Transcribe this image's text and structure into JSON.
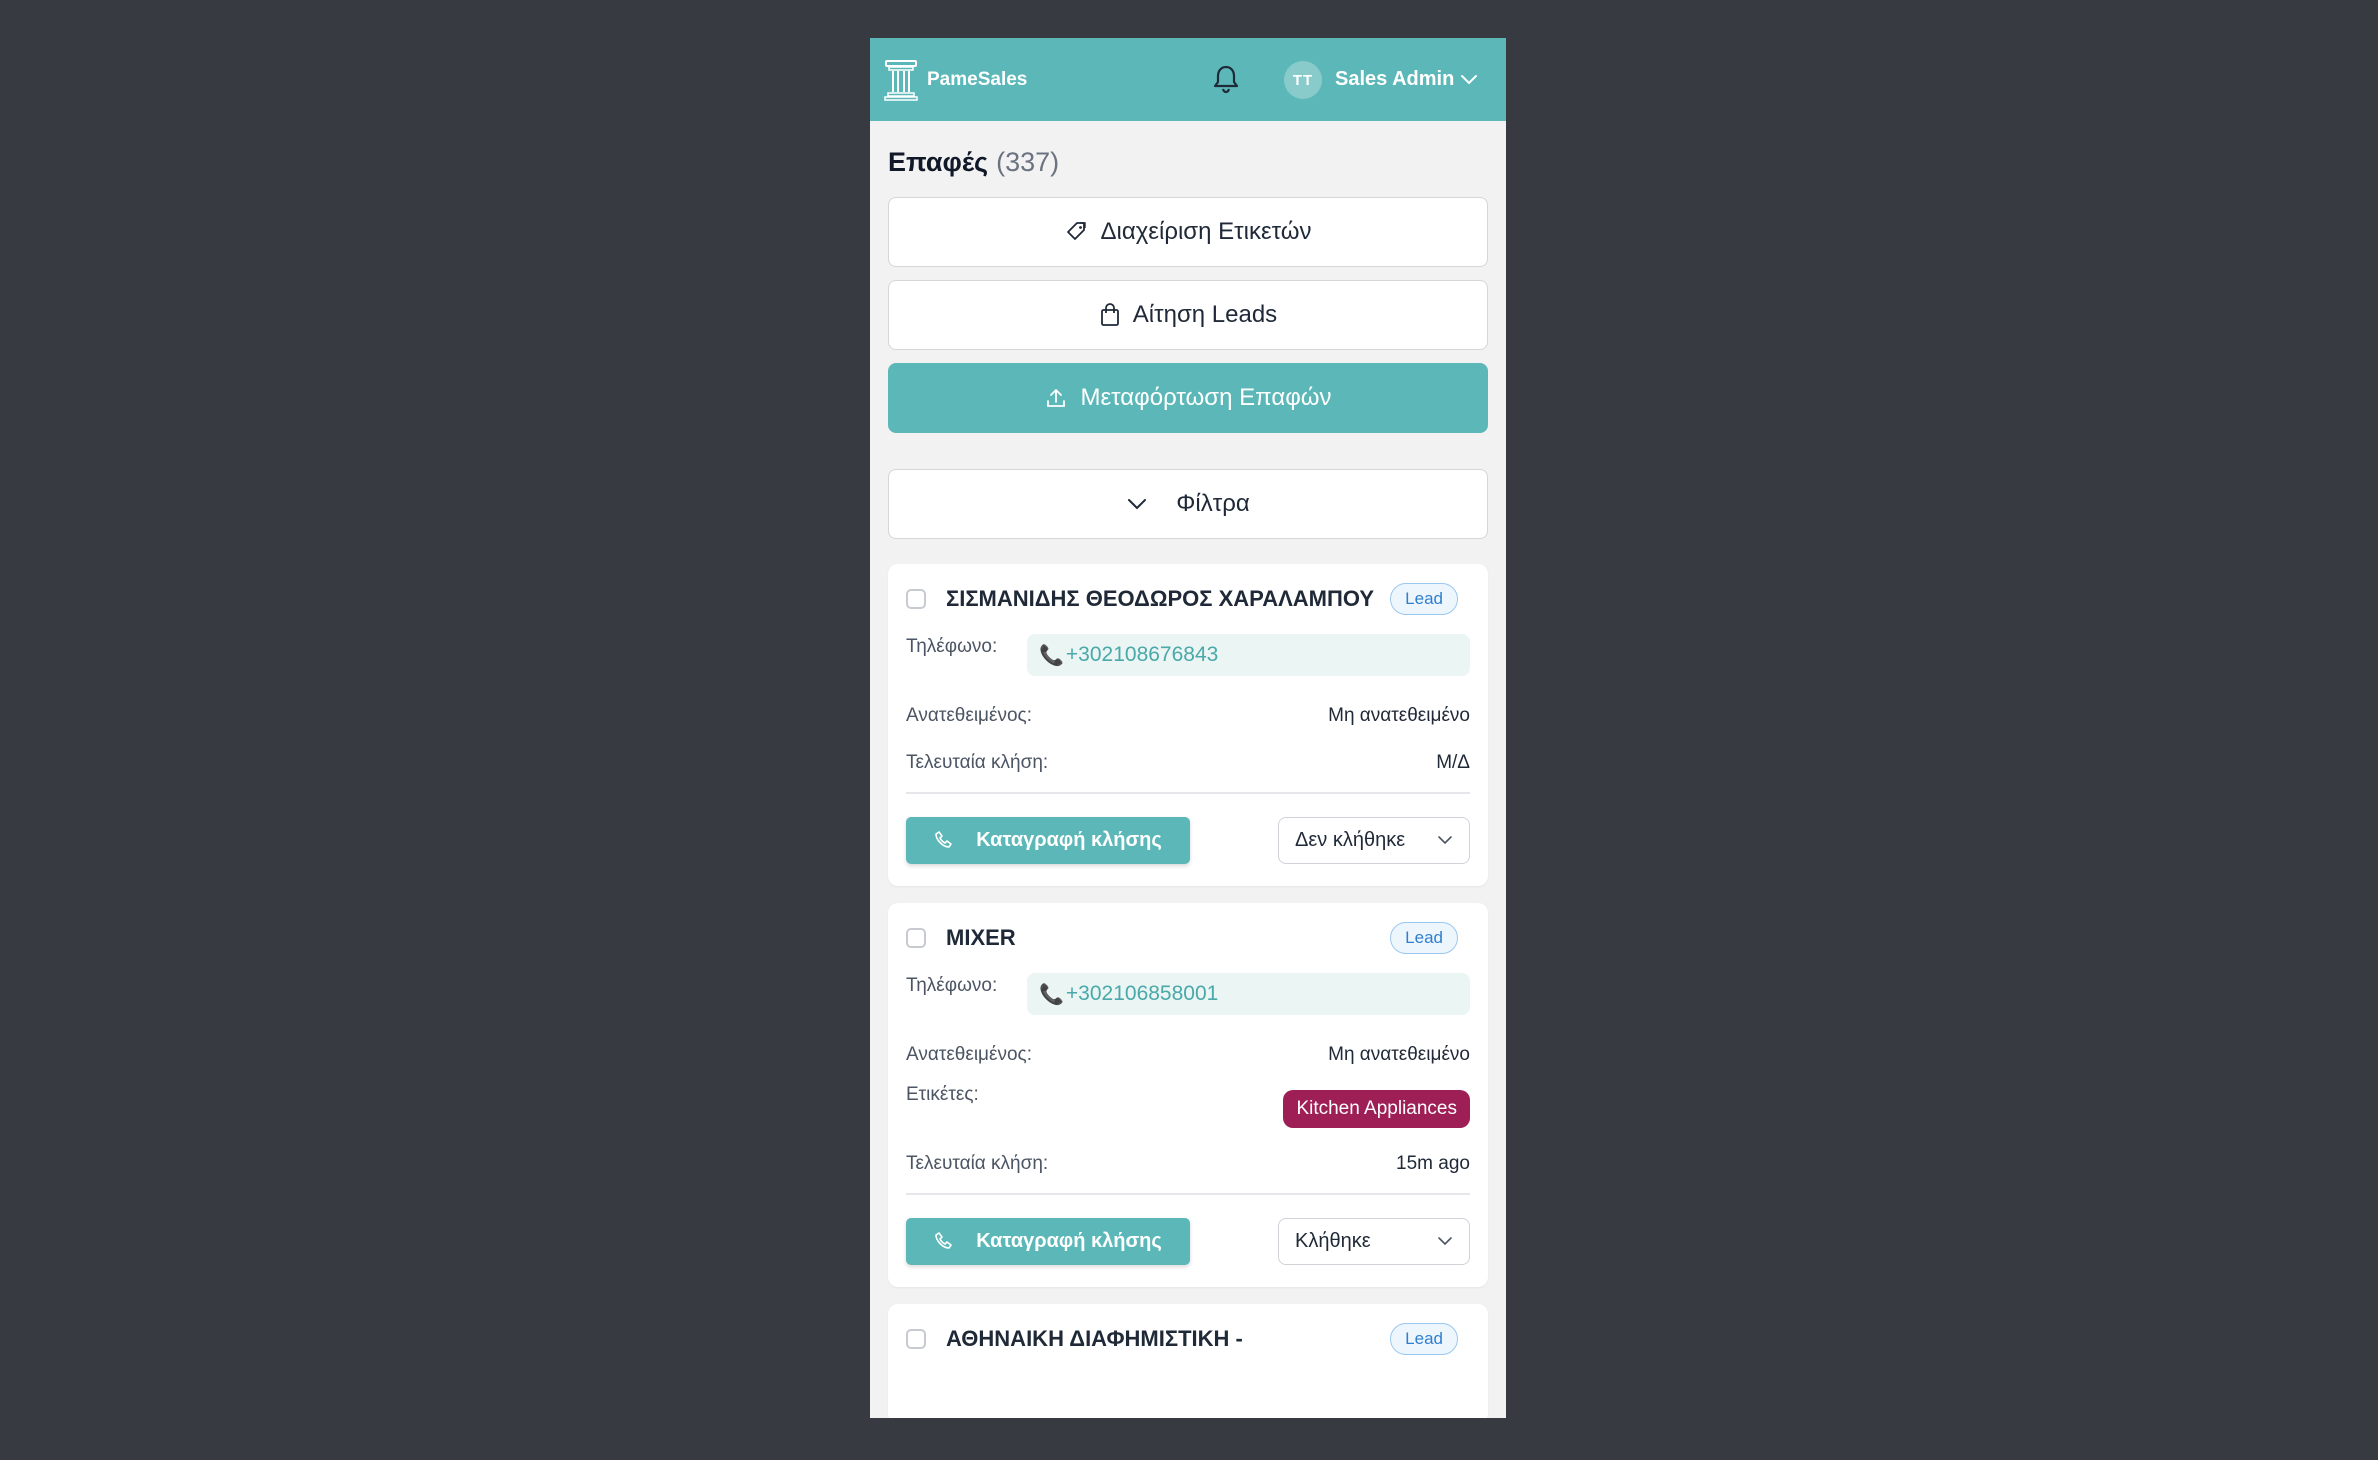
{
  "header": {
    "brand": "PameSales",
    "avatar_initials": "TT",
    "user_name": "Sales Admin",
    "accent_color": "#5cb8b8"
  },
  "page": {
    "title": "Επαφές",
    "count": "(337)"
  },
  "actions": {
    "manage_tags": "Διαχείριση Ετικετών",
    "request_leads": "Αίτηση Leads",
    "upload_contacts": "Μεταφόρτωση Επαφών",
    "filters": "Φίλτρα"
  },
  "labels": {
    "phone": "Τηλέφωνο:",
    "assigned": "Ανατεθειμένος:",
    "tags": "Ετικέτες:",
    "last_call": "Τελευταία κλήση:",
    "record_call": "Καταγραφή κλήσης"
  },
  "contacts": [
    {
      "name": "ΣΙΣΜΑΝΙΔΗΣ ΘΕΟΔΩΡΟΣ ΧΑΡΑΛΑΜΠΟΥ",
      "badge": "Lead",
      "phone": "+302108676843",
      "assigned": "Μη ανατεθειμένο",
      "last_call": "Μ/Δ",
      "status": "Δεν κλήθηκε"
    },
    {
      "name": "MIXER",
      "badge": "Lead",
      "phone": "+302106858001",
      "assigned": "Μη ανατεθειμένο",
      "tag": "Kitchen Appliances",
      "tag_color": "#9e1f56",
      "last_call": "15m ago",
      "status": "Κλήθηκε"
    },
    {
      "name": "ΑΘΗΝΑΙΚΗ ΔΙΑΦΗΜΙΣΤΙΚΗ -",
      "badge": "Lead"
    }
  ]
}
